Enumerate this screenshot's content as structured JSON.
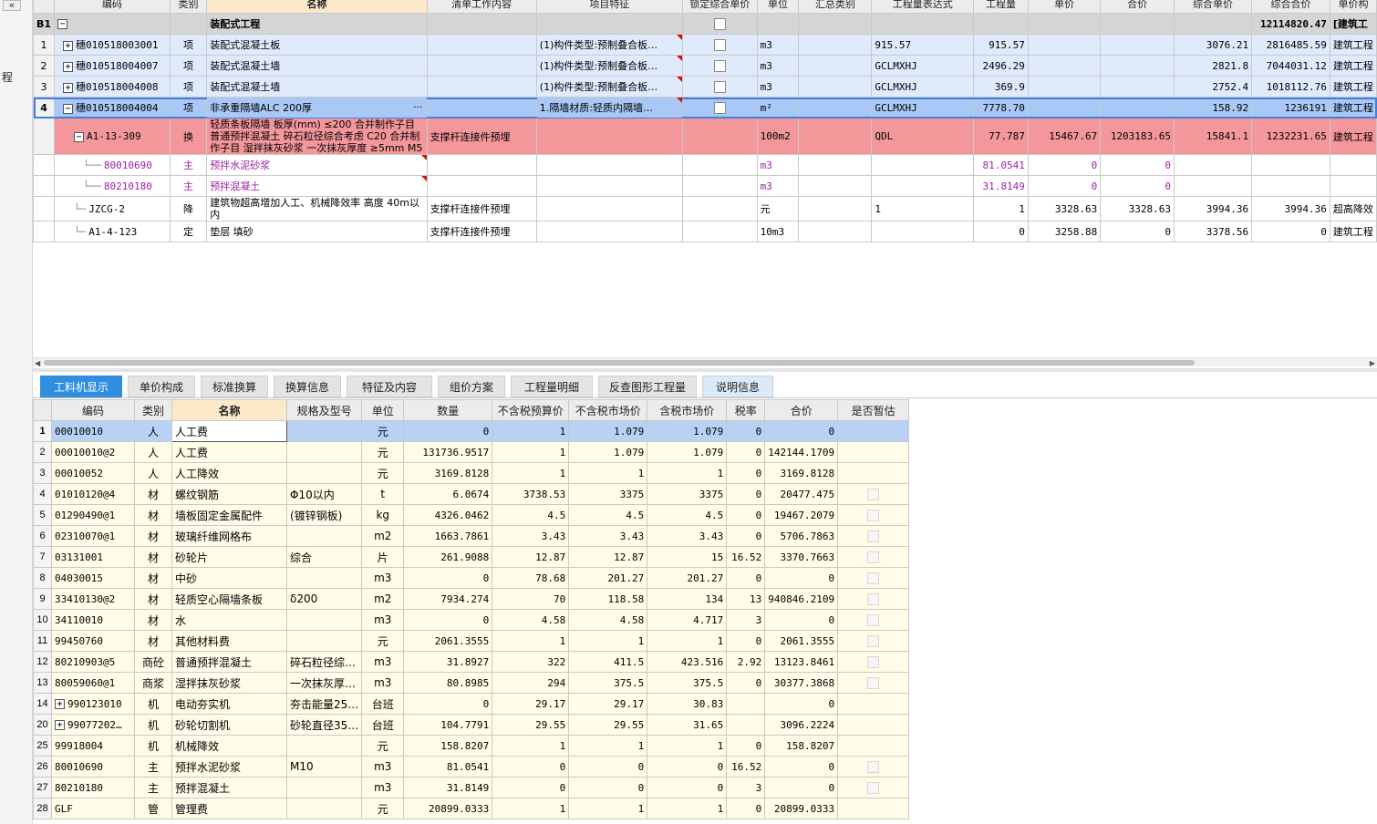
{
  "sidebar": {
    "collapse_label": "«",
    "left_glyph": "程"
  },
  "top_grid": {
    "headers": [
      "",
      "编码",
      "类别",
      "名称",
      "清单工作内容",
      "项目特征",
      "锁定综合单价",
      "单位",
      "汇总类别",
      "工程量表达式",
      "工程量",
      "单价",
      "合价",
      "综合单价",
      "综合合价",
      "单价构"
    ],
    "rows": [
      {
        "kind": "grp",
        "rownum": "B1",
        "expander": "−",
        "code": "",
        "type": "",
        "name": "装配式工程",
        "work": "",
        "feature": "",
        "lock": true,
        "unit": "",
        "sumtype": "",
        "expr": "",
        "qty": "",
        "price": "",
        "amount": "",
        "cprice": "",
        "camount": "12114820.47",
        "build": "[建筑工"
      },
      {
        "kind": "qd",
        "rownum": "1",
        "expander": "+",
        "code": "穗010518003001",
        "type": "项",
        "name": "装配式混凝土板",
        "work": "",
        "feature": "(1)构件类型:预制叠合板…",
        "lock": true,
        "unit": "m3",
        "sumtype": "",
        "expr": "915.57",
        "qty": "915.57",
        "price": "",
        "amount": "",
        "cprice": "3076.21",
        "camount": "2816485.59",
        "build": "建筑工程"
      },
      {
        "kind": "qd",
        "rownum": "2",
        "expander": "+",
        "code": "穗010518004007",
        "type": "项",
        "name": "装配式混凝土墙",
        "work": "",
        "feature": "(1)构件类型:预制叠合板…",
        "lock": true,
        "unit": "m3",
        "sumtype": "",
        "expr": "GCLMXHJ",
        "qty": "2496.29",
        "price": "",
        "amount": "",
        "cprice": "2821.8",
        "camount": "7044031.12",
        "build": "建筑工程"
      },
      {
        "kind": "qd",
        "rownum": "3",
        "expander": "+",
        "code": "穗010518004008",
        "type": "项",
        "name": "装配式混凝土墙",
        "work": "",
        "feature": "(1)构件类型:预制叠合板…",
        "lock": true,
        "unit": "m3",
        "sumtype": "",
        "expr": "GCLMXHJ",
        "qty": "369.9",
        "price": "",
        "amount": "",
        "cprice": "2752.4",
        "camount": "1018112.76",
        "build": "建筑工程"
      },
      {
        "kind": "sel",
        "rownum": "4",
        "expander": "−",
        "code": "穗010518004004",
        "type": "项",
        "name": "非承重隔墙ALC 200厚",
        "work": "",
        "feature": "1.隔墙材质:轻质内隔墙…",
        "lock": true,
        "unit": "m²",
        "sumtype": "",
        "expr": "GCLMXHJ",
        "qty": "7778.70",
        "price": "",
        "amount": "",
        "cprice": "158.92",
        "camount": "1236191",
        "build": "建筑工程"
      },
      {
        "kind": "de",
        "rownum": "",
        "expander": "−",
        "code": "A1-13-309",
        "type": "换",
        "name": "轻质条板隔墙 板厚(mm) ≤200  合并制作子目 普通预拌混凝土 碎石粒径综合考虑 C20 合并制作子目 湿拌抹灰砂浆 一次抹灰厚度 ≥5mm M5",
        "work": "支撑杆连接件预埋",
        "feature": "",
        "lock": false,
        "unit": "100m2",
        "sumtype": "",
        "expr": "QDL",
        "qty": "77.787",
        "price": "15467.67",
        "amount": "1203183.65",
        "cprice": "15841.1",
        "camount": "1232231.65",
        "build": "建筑工程"
      },
      {
        "kind": "mat",
        "rownum": "",
        "expander": "",
        "code": "80010690",
        "type": "主",
        "name": "预拌水泥砂浆",
        "work": "",
        "feature": "",
        "lock": false,
        "unit": "m3",
        "sumtype": "",
        "expr": "",
        "qty": "81.0541",
        "price": "0",
        "amount": "0",
        "cprice": "",
        "camount": "",
        "build": ""
      },
      {
        "kind": "mat",
        "rownum": "",
        "expander": "",
        "code": "80210180",
        "type": "主",
        "name": "预拌混凝土",
        "work": "",
        "feature": "",
        "lock": false,
        "unit": "m3",
        "sumtype": "",
        "expr": "",
        "qty": "31.8149",
        "price": "0",
        "amount": "0",
        "cprice": "",
        "camount": "",
        "build": ""
      },
      {
        "kind": "plain",
        "rownum": "",
        "expander": "",
        "code": "JZCG-2",
        "type": "降",
        "name": "建筑物超高增加人工、机械降效率 高度 40m以内",
        "work": "支撑杆连接件预埋",
        "feature": "",
        "lock": false,
        "unit": "元",
        "sumtype": "",
        "expr": "1",
        "qty": "1",
        "price": "3328.63",
        "amount": "3328.63",
        "cprice": "3994.36",
        "camount": "3994.36",
        "build": "超高降效"
      },
      {
        "kind": "plain",
        "rownum": "",
        "expander": "",
        "code": "A1-4-123",
        "type": "定",
        "name": "垫层 填砂",
        "work": "支撑杆连接件预埋",
        "feature": "",
        "lock": false,
        "unit": "10m3",
        "sumtype": "",
        "expr": "",
        "qty": "0",
        "price": "3258.88",
        "amount": "0",
        "cprice": "3378.56",
        "camount": "0",
        "build": "建筑工程"
      }
    ],
    "name_ellipsis": "···"
  },
  "scroll": {
    "left": "◀",
    "right": "▶"
  },
  "tabs": [
    {
      "label": "工料机显示",
      "state": "active"
    },
    {
      "label": "单价构成",
      "state": "normal"
    },
    {
      "label": "标准换算",
      "state": "normal"
    },
    {
      "label": "换算信息",
      "state": "normal"
    },
    {
      "label": "特征及内容",
      "state": "normal"
    },
    {
      "label": "组价方案",
      "state": "normal"
    },
    {
      "label": "工程量明细",
      "state": "normal"
    },
    {
      "label": "反查图形工程量",
      "state": "normal"
    },
    {
      "label": "说明信息",
      "state": "light"
    }
  ],
  "bottom_grid": {
    "headers": [
      "",
      "编码",
      "类别",
      "名称",
      "规格及型号",
      "单位",
      "数量",
      "不含税预算价",
      "不含税市场价",
      "含税市场价",
      "税率",
      "合价",
      "是否暂估"
    ],
    "rows": [
      {
        "rn": "1",
        "exp": "",
        "code": "00010010",
        "type": "人",
        "name": "人工费",
        "spec": "",
        "unit": "元",
        "qty": "0",
        "budget": "1",
        "market": "1.079",
        "taxmarket": "1.079",
        "rate": "0",
        "total": "0",
        "chk": false
      },
      {
        "rn": "2",
        "exp": "",
        "code": "00010010@2",
        "type": "人",
        "name": "人工费",
        "spec": "",
        "unit": "元",
        "qty": "131736.9517",
        "budget": "1",
        "market": "1.079",
        "taxmarket": "1.079",
        "rate": "0",
        "total": "142144.1709",
        "chk": false
      },
      {
        "rn": "3",
        "exp": "",
        "code": "00010052",
        "type": "人",
        "name": "人工降效",
        "spec": "",
        "unit": "元",
        "qty": "3169.8128",
        "budget": "1",
        "market": "1",
        "taxmarket": "1",
        "rate": "0",
        "total": "3169.8128",
        "chk": false
      },
      {
        "rn": "4",
        "exp": "",
        "code": "01010120@4",
        "type": "材",
        "name": "螺纹钢筋",
        "spec": "Φ10以内",
        "unit": "t",
        "qty": "6.0674",
        "budget": "3738.53",
        "market": "3375",
        "taxmarket": "3375",
        "rate": "0",
        "total": "20477.475",
        "chk": true
      },
      {
        "rn": "5",
        "exp": "",
        "code": "01290490@1",
        "type": "材",
        "name": "墙板固定金属配件",
        "spec": "(镀锌钢板)",
        "unit": "kg",
        "qty": "4326.0462",
        "budget": "4.5",
        "market": "4.5",
        "taxmarket": "4.5",
        "rate": "0",
        "total": "19467.2079",
        "chk": true
      },
      {
        "rn": "6",
        "exp": "",
        "code": "02310070@1",
        "type": "材",
        "name": "玻璃纤维网格布",
        "spec": "",
        "unit": "m2",
        "qty": "1663.7861",
        "budget": "3.43",
        "market": "3.43",
        "taxmarket": "3.43",
        "rate": "0",
        "total": "5706.7863",
        "chk": true
      },
      {
        "rn": "7",
        "exp": "",
        "code": "03131001",
        "type": "材",
        "name": "砂轮片",
        "spec": "综合",
        "unit": "片",
        "qty": "261.9088",
        "budget": "12.87",
        "market": "12.87",
        "taxmarket": "15",
        "rate": "16.52",
        "total": "3370.7663",
        "chk": true
      },
      {
        "rn": "8",
        "exp": "",
        "code": "04030015",
        "type": "材",
        "name": "中砂",
        "spec": "",
        "unit": "m3",
        "qty": "0",
        "budget": "78.68",
        "market": "201.27",
        "taxmarket": "201.27",
        "rate": "0",
        "total": "0",
        "chk": true
      },
      {
        "rn": "9",
        "exp": "",
        "code": "33410130@2",
        "type": "材",
        "name": "轻质空心隔墙条板",
        "spec": "δ200",
        "unit": "m2",
        "qty": "7934.274",
        "budget": "70",
        "market": "118.58",
        "taxmarket": "134",
        "rate": "13",
        "total": "940846.2109",
        "chk": true
      },
      {
        "rn": "10",
        "exp": "",
        "code": "34110010",
        "type": "材",
        "name": "水",
        "spec": "",
        "unit": "m3",
        "qty": "0",
        "budget": "4.58",
        "market": "4.58",
        "taxmarket": "4.717",
        "rate": "3",
        "total": "0",
        "chk": true
      },
      {
        "rn": "11",
        "exp": "",
        "code": "99450760",
        "type": "材",
        "name": "其他材料费",
        "spec": "",
        "unit": "元",
        "qty": "2061.3555",
        "budget": "1",
        "market": "1",
        "taxmarket": "1",
        "rate": "0",
        "total": "2061.3555",
        "chk": true
      },
      {
        "rn": "12",
        "exp": "",
        "code": "80210903@5",
        "type": "商砼",
        "name": "普通预拌混凝土",
        "spec": "碎石粒径综…",
        "unit": "m3",
        "qty": "31.8927",
        "budget": "322",
        "market": "411.5",
        "taxmarket": "423.516",
        "rate": "2.92",
        "total": "13123.8461",
        "chk": true
      },
      {
        "rn": "13",
        "exp": "",
        "code": "80059060@1",
        "type": "商浆",
        "name": "湿拌抹灰砂浆",
        "spec": "一次抹灰厚…",
        "unit": "m3",
        "qty": "80.8985",
        "budget": "294",
        "market": "375.5",
        "taxmarket": "375.5",
        "rate": "0",
        "total": "30377.3868",
        "chk": true
      },
      {
        "rn": "14",
        "exp": "+",
        "code": "990123010",
        "type": "机",
        "name": "电动夯实机",
        "spec": "夯击能量25…",
        "unit": "台班",
        "qty": "0",
        "budget": "29.17",
        "market": "29.17",
        "taxmarket": "30.83",
        "rate": "",
        "total": "0",
        "chk": false
      },
      {
        "rn": "20",
        "exp": "+",
        "code": "99077202…",
        "type": "机",
        "name": "砂轮切割机",
        "spec": "砂轮直径35…",
        "unit": "台班",
        "qty": "104.7791",
        "budget": "29.55",
        "market": "29.55",
        "taxmarket": "31.65",
        "rate": "",
        "total": "3096.2224",
        "chk": false
      },
      {
        "rn": "25",
        "exp": "",
        "code": "99918004",
        "type": "机",
        "name": "机械降效",
        "spec": "",
        "unit": "元",
        "qty": "158.8207",
        "budget": "1",
        "market": "1",
        "taxmarket": "1",
        "rate": "0",
        "total": "158.8207",
        "chk": false
      },
      {
        "rn": "26",
        "exp": "",
        "code": "80010690",
        "type": "主",
        "name": "预拌水泥砂浆",
        "spec": "M10",
        "unit": "m3",
        "qty": "81.0541",
        "budget": "0",
        "market": "0",
        "taxmarket": "0",
        "rate": "16.52",
        "total": "0",
        "chk": true
      },
      {
        "rn": "27",
        "exp": "",
        "code": "80210180",
        "type": "主",
        "name": "预拌混凝土",
        "spec": "",
        "unit": "m3",
        "qty": "31.8149",
        "budget": "0",
        "market": "0",
        "taxmarket": "0",
        "rate": "3",
        "total": "0",
        "chk": true
      },
      {
        "rn": "28",
        "exp": "",
        "code": "GLF",
        "type": "管",
        "name": "管理费",
        "spec": "",
        "unit": "元",
        "qty": "20899.0333",
        "budget": "1",
        "market": "1",
        "taxmarket": "1",
        "rate": "0",
        "total": "20899.0333",
        "chk": false
      }
    ]
  }
}
